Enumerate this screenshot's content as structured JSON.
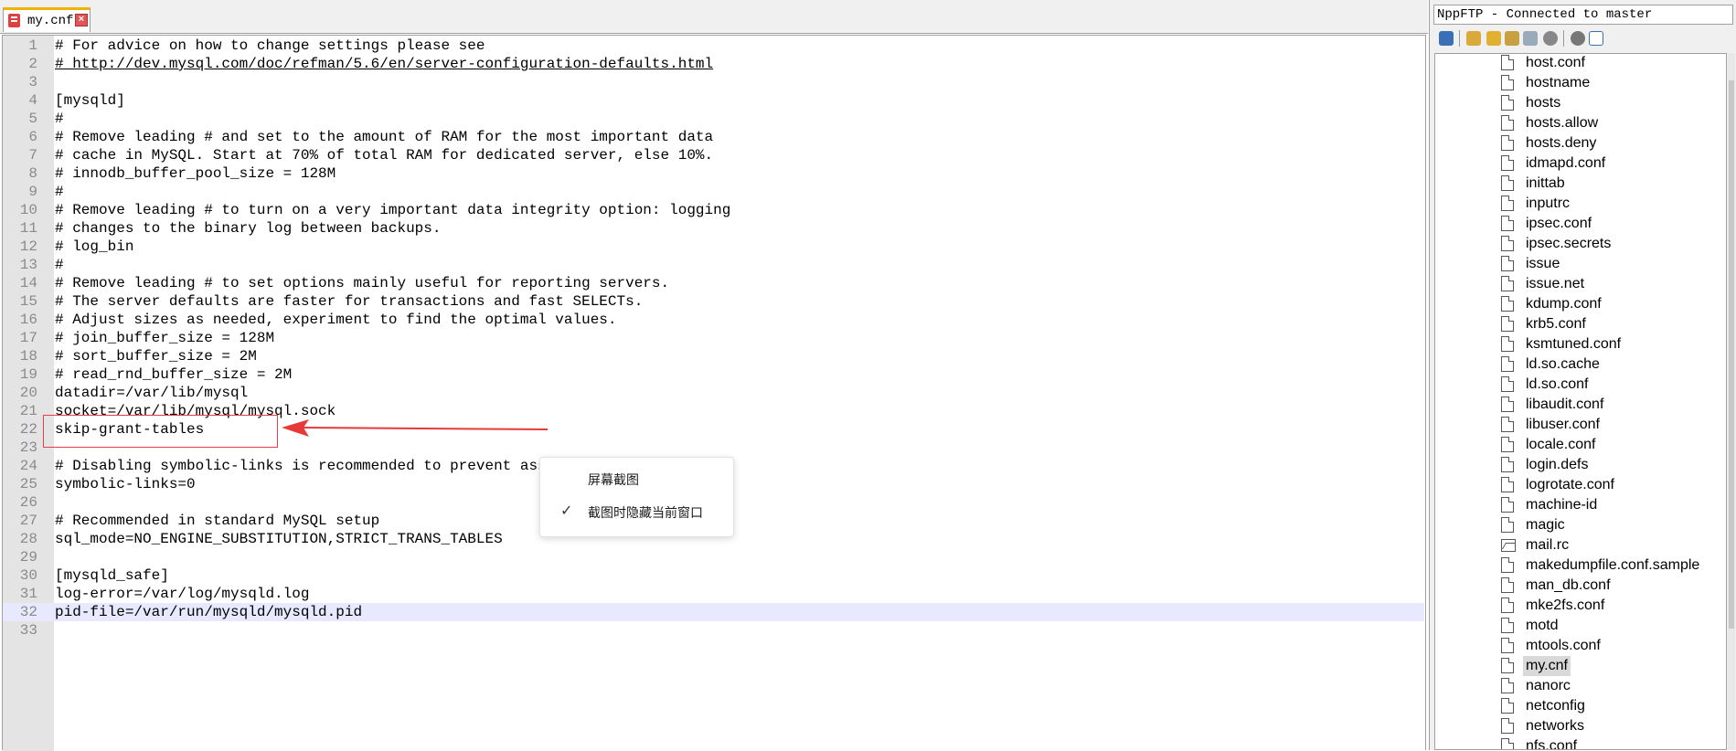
{
  "tab": {
    "label": "my.cnf"
  },
  "editor": {
    "lines": [
      {
        "n": "1",
        "text": "# For advice on how to change settings please see"
      },
      {
        "n": "2",
        "text": "# http://dev.mysql.com/doc/refman/5.6/en/server-configuration-defaults.html"
      },
      {
        "n": "3",
        "text": ""
      },
      {
        "n": "4",
        "text": "[mysqld]"
      },
      {
        "n": "5",
        "text": "#"
      },
      {
        "n": "6",
        "text": "# Remove leading # and set to the amount of RAM for the most important data"
      },
      {
        "n": "7",
        "text": "# cache in MySQL. Start at 70% of total RAM for dedicated server, else 10%."
      },
      {
        "n": "8",
        "text": "# innodb_buffer_pool_size = 128M"
      },
      {
        "n": "9",
        "text": "#"
      },
      {
        "n": "10",
        "text": "# Remove leading # to turn on a very important data integrity option: logging"
      },
      {
        "n": "11",
        "text": "# changes to the binary log between backups."
      },
      {
        "n": "12",
        "text": "# log_bin"
      },
      {
        "n": "13",
        "text": "#"
      },
      {
        "n": "14",
        "text": "# Remove leading # to set options mainly useful for reporting servers."
      },
      {
        "n": "15",
        "text": "# The server defaults are faster for transactions and fast SELECTs."
      },
      {
        "n": "16",
        "text": "# Adjust sizes as needed, experiment to find the optimal values."
      },
      {
        "n": "17",
        "text": "# join_buffer_size = 128M"
      },
      {
        "n": "18",
        "text": "# sort_buffer_size = 2M"
      },
      {
        "n": "19",
        "text": "# read_rnd_buffer_size = 2M"
      },
      {
        "n": "20",
        "text": "datadir=/var/lib/mysql"
      },
      {
        "n": "21",
        "text": "socket=/var/lib/mysql/mysql.sock"
      },
      {
        "n": "22",
        "text": "skip-grant-tables"
      },
      {
        "n": "23",
        "text": ""
      },
      {
        "n": "24",
        "text": "# Disabling symbolic-links is recommended to prevent assorted security risks"
      },
      {
        "n": "25",
        "text": "symbolic-links=0"
      },
      {
        "n": "26",
        "text": ""
      },
      {
        "n": "27",
        "text": "# Recommended in standard MySQL setup"
      },
      {
        "n": "28",
        "text": "sql_mode=NO_ENGINE_SUBSTITUTION,STRICT_TRANS_TABLES"
      },
      {
        "n": "29",
        "text": ""
      },
      {
        "n": "30",
        "text": "[mysqld_safe]"
      },
      {
        "n": "31",
        "text": "log-error=/var/log/mysqld.log"
      },
      {
        "n": "32",
        "text": "pid-file=/var/run/mysqld/mysqld.pid"
      },
      {
        "n": "33",
        "text": ""
      }
    ]
  },
  "context_menu": {
    "item1": "屏幕截图",
    "item2": "截图时隐藏当前窗口",
    "check": "✓"
  },
  "ftp": {
    "title": "NppFTP - Connected to master",
    "files": [
      "host.conf",
      "hostname",
      "hosts",
      "hosts.allow",
      "hosts.deny",
      "idmapd.conf",
      "inittab",
      "inputrc",
      "ipsec.conf",
      "ipsec.secrets",
      "issue",
      "issue.net",
      "kdump.conf",
      "krb5.conf",
      "ksmtuned.conf",
      "ld.so.cache",
      "ld.so.conf",
      "libaudit.conf",
      "libuser.conf",
      "locale.conf",
      "login.defs",
      "logrotate.conf",
      "machine-id",
      "magic",
      "mail.rc",
      "makedumpfile.conf.sample",
      "man_db.conf",
      "mke2fs.conf",
      "motd",
      "mtools.conf",
      "my.cnf",
      "nanorc",
      "netconfig",
      "networks",
      "nfs.conf"
    ],
    "selected": "my.cnf",
    "image_icon_file": "mail.rc"
  },
  "colors": {
    "highlight_box": "#e04050",
    "arrow": "#e8393a",
    "current_line": "#e8e8ff",
    "gutter": "#e4e4e4"
  }
}
